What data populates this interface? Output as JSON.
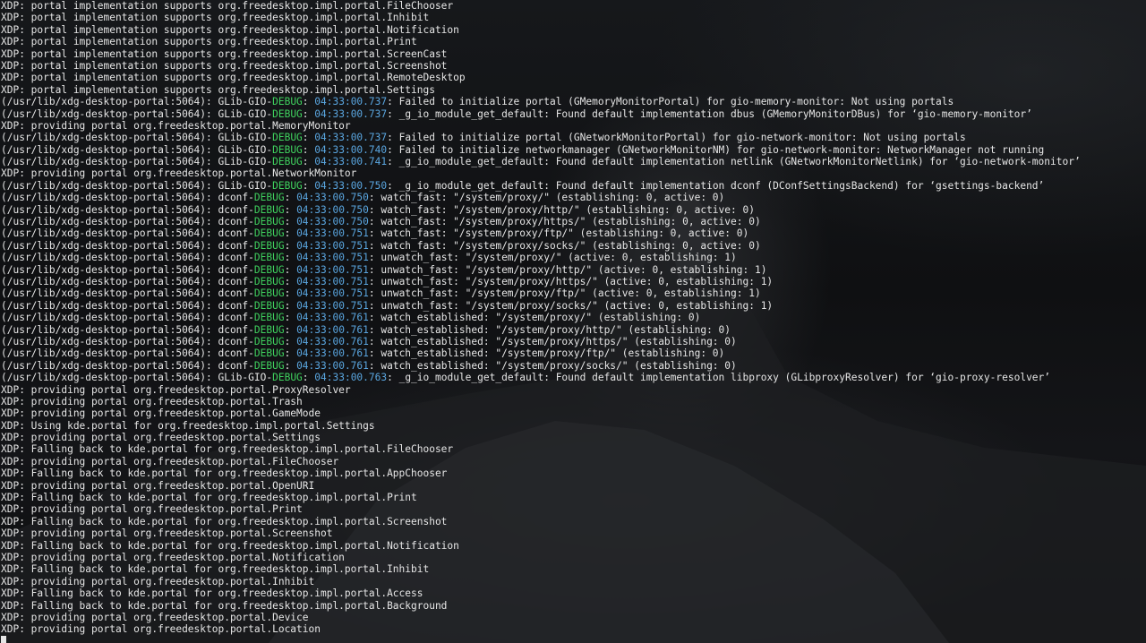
{
  "terminal": {
    "colors": {
      "text": "#e6e6e6",
      "debug": "#3fd15e",
      "timestamp": "#5aa6e0",
      "background": "#0c0d0f"
    },
    "lines": [
      [
        {
          "t": "XDP: portal implementation supports org.freedesktop.impl.portal.FileChooser"
        }
      ],
      [
        {
          "t": "XDP: portal implementation supports org.freedesktop.impl.portal.Inhibit"
        }
      ],
      [
        {
          "t": "XDP: portal implementation supports org.freedesktop.impl.portal.Notification"
        }
      ],
      [
        {
          "t": "XDP: portal implementation supports org.freedesktop.impl.portal.Print"
        }
      ],
      [
        {
          "t": "XDP: portal implementation supports org.freedesktop.impl.portal.ScreenCast"
        }
      ],
      [
        {
          "t": "XDP: portal implementation supports org.freedesktop.impl.portal.Screenshot"
        }
      ],
      [
        {
          "t": "XDP: portal implementation supports org.freedesktop.impl.portal.RemoteDesktop"
        }
      ],
      [
        {
          "t": "XDP: portal implementation supports org.freedesktop.impl.portal.Settings"
        }
      ],
      [
        {
          "t": "(/usr/lib/xdg-desktop-portal:5064): GLib-GIO-"
        },
        {
          "t": "DEBUG",
          "c": "debug"
        },
        {
          "t": ": "
        },
        {
          "t": "04:33:00.737",
          "c": "time"
        },
        {
          "t": ": Failed to initialize portal (GMemoryMonitorPortal) for gio-memory-monitor: Not using portals"
        }
      ],
      [
        {
          "t": "(/usr/lib/xdg-desktop-portal:5064): GLib-GIO-"
        },
        {
          "t": "DEBUG",
          "c": "debug"
        },
        {
          "t": ": "
        },
        {
          "t": "04:33:00.737",
          "c": "time"
        },
        {
          "t": ": _g_io_module_get_default: Found default implementation dbus (GMemoryMonitorDBus) for ‘gio-memory-monitor’"
        }
      ],
      [
        {
          "t": "XDP: providing portal org.freedesktop.portal.MemoryMonitor"
        }
      ],
      [
        {
          "t": "(/usr/lib/xdg-desktop-portal:5064): GLib-GIO-"
        },
        {
          "t": "DEBUG",
          "c": "debug"
        },
        {
          "t": ": "
        },
        {
          "t": "04:33:00.737",
          "c": "time"
        },
        {
          "t": ": Failed to initialize portal (GNetworkMonitorPortal) for gio-network-monitor: Not using portals"
        }
      ],
      [
        {
          "t": "(/usr/lib/xdg-desktop-portal:5064): GLib-GIO-"
        },
        {
          "t": "DEBUG",
          "c": "debug"
        },
        {
          "t": ": "
        },
        {
          "t": "04:33:00.740",
          "c": "time"
        },
        {
          "t": ": Failed to initialize networkmanager (GNetworkMonitorNM) for gio-network-monitor: NetworkManager not running"
        }
      ],
      [
        {
          "t": "(/usr/lib/xdg-desktop-portal:5064): GLib-GIO-"
        },
        {
          "t": "DEBUG",
          "c": "debug"
        },
        {
          "t": ": "
        },
        {
          "t": "04:33:00.741",
          "c": "time"
        },
        {
          "t": ": _g_io_module_get_default: Found default implementation netlink (GNetworkMonitorNetlink) for ‘gio-network-monitor’"
        }
      ],
      [
        {
          "t": "XDP: providing portal org.freedesktop.portal.NetworkMonitor"
        }
      ],
      [
        {
          "t": "(/usr/lib/xdg-desktop-portal:5064): GLib-GIO-"
        },
        {
          "t": "DEBUG",
          "c": "debug"
        },
        {
          "t": ": "
        },
        {
          "t": "04:33:00.750",
          "c": "time"
        },
        {
          "t": ": _g_io_module_get_default: Found default implementation dconf (DConfSettingsBackend) for ‘gsettings-backend’"
        }
      ],
      [
        {
          "t": "(/usr/lib/xdg-desktop-portal:5064): dconf-"
        },
        {
          "t": "DEBUG",
          "c": "debug"
        },
        {
          "t": ": "
        },
        {
          "t": "04:33:00.750",
          "c": "time"
        },
        {
          "t": ": watch_fast: \"/system/proxy/\" (establishing: 0, active: 0)"
        }
      ],
      [
        {
          "t": "(/usr/lib/xdg-desktop-portal:5064): dconf-"
        },
        {
          "t": "DEBUG",
          "c": "debug"
        },
        {
          "t": ": "
        },
        {
          "t": "04:33:00.750",
          "c": "time"
        },
        {
          "t": ": watch_fast: \"/system/proxy/http/\" (establishing: 0, active: 0)"
        }
      ],
      [
        {
          "t": "(/usr/lib/xdg-desktop-portal:5064): dconf-"
        },
        {
          "t": "DEBUG",
          "c": "debug"
        },
        {
          "t": ": "
        },
        {
          "t": "04:33:00.750",
          "c": "time"
        },
        {
          "t": ": watch_fast: \"/system/proxy/https/\" (establishing: 0, active: 0)"
        }
      ],
      [
        {
          "t": "(/usr/lib/xdg-desktop-portal:5064): dconf-"
        },
        {
          "t": "DEBUG",
          "c": "debug"
        },
        {
          "t": ": "
        },
        {
          "t": "04:33:00.751",
          "c": "time"
        },
        {
          "t": ": watch_fast: \"/system/proxy/ftp/\" (establishing: 0, active: 0)"
        }
      ],
      [
        {
          "t": "(/usr/lib/xdg-desktop-portal:5064): dconf-"
        },
        {
          "t": "DEBUG",
          "c": "debug"
        },
        {
          "t": ": "
        },
        {
          "t": "04:33:00.751",
          "c": "time"
        },
        {
          "t": ": watch_fast: \"/system/proxy/socks/\" (establishing: 0, active: 0)"
        }
      ],
      [
        {
          "t": "(/usr/lib/xdg-desktop-portal:5064): dconf-"
        },
        {
          "t": "DEBUG",
          "c": "debug"
        },
        {
          "t": ": "
        },
        {
          "t": "04:33:00.751",
          "c": "time"
        },
        {
          "t": ": unwatch_fast: \"/system/proxy/\" (active: 0, establishing: 1)"
        }
      ],
      [
        {
          "t": "(/usr/lib/xdg-desktop-portal:5064): dconf-"
        },
        {
          "t": "DEBUG",
          "c": "debug"
        },
        {
          "t": ": "
        },
        {
          "t": "04:33:00.751",
          "c": "time"
        },
        {
          "t": ": unwatch_fast: \"/system/proxy/http/\" (active: 0, establishing: 1)"
        }
      ],
      [
        {
          "t": "(/usr/lib/xdg-desktop-portal:5064): dconf-"
        },
        {
          "t": "DEBUG",
          "c": "debug"
        },
        {
          "t": ": "
        },
        {
          "t": "04:33:00.751",
          "c": "time"
        },
        {
          "t": ": unwatch_fast: \"/system/proxy/https/\" (active: 0, establishing: 1)"
        }
      ],
      [
        {
          "t": "(/usr/lib/xdg-desktop-portal:5064): dconf-"
        },
        {
          "t": "DEBUG",
          "c": "debug"
        },
        {
          "t": ": "
        },
        {
          "t": "04:33:00.751",
          "c": "time"
        },
        {
          "t": ": unwatch_fast: \"/system/proxy/ftp/\" (active: 0, establishing: 1)"
        }
      ],
      [
        {
          "t": "(/usr/lib/xdg-desktop-portal:5064): dconf-"
        },
        {
          "t": "DEBUG",
          "c": "debug"
        },
        {
          "t": ": "
        },
        {
          "t": "04:33:00.751",
          "c": "time"
        },
        {
          "t": ": unwatch_fast: \"/system/proxy/socks/\" (active: 0, establishing: 1)"
        }
      ],
      [
        {
          "t": "(/usr/lib/xdg-desktop-portal:5064): dconf-"
        },
        {
          "t": "DEBUG",
          "c": "debug"
        },
        {
          "t": ": "
        },
        {
          "t": "04:33:00.761",
          "c": "time"
        },
        {
          "t": ": watch_established: \"/system/proxy/\" (establishing: 0)"
        }
      ],
      [
        {
          "t": "(/usr/lib/xdg-desktop-portal:5064): dconf-"
        },
        {
          "t": "DEBUG",
          "c": "debug"
        },
        {
          "t": ": "
        },
        {
          "t": "04:33:00.761",
          "c": "time"
        },
        {
          "t": ": watch_established: \"/system/proxy/http/\" (establishing: 0)"
        }
      ],
      [
        {
          "t": "(/usr/lib/xdg-desktop-portal:5064): dconf-"
        },
        {
          "t": "DEBUG",
          "c": "debug"
        },
        {
          "t": ": "
        },
        {
          "t": "04:33:00.761",
          "c": "time"
        },
        {
          "t": ": watch_established: \"/system/proxy/https/\" (establishing: 0)"
        }
      ],
      [
        {
          "t": "(/usr/lib/xdg-desktop-portal:5064): dconf-"
        },
        {
          "t": "DEBUG",
          "c": "debug"
        },
        {
          "t": ": "
        },
        {
          "t": "04:33:00.761",
          "c": "time"
        },
        {
          "t": ": watch_established: \"/system/proxy/ftp/\" (establishing: 0)"
        }
      ],
      [
        {
          "t": "(/usr/lib/xdg-desktop-portal:5064): dconf-"
        },
        {
          "t": "DEBUG",
          "c": "debug"
        },
        {
          "t": ": "
        },
        {
          "t": "04:33:00.761",
          "c": "time"
        },
        {
          "t": ": watch_established: \"/system/proxy/socks/\" (establishing: 0)"
        }
      ],
      [
        {
          "t": "(/usr/lib/xdg-desktop-portal:5064): GLib-GIO-"
        },
        {
          "t": "DEBUG",
          "c": "debug"
        },
        {
          "t": ": "
        },
        {
          "t": "04:33:00.763",
          "c": "time"
        },
        {
          "t": ": _g_io_module_get_default: Found default implementation libproxy (GLibproxyResolver) for ‘gio-proxy-resolver’"
        }
      ],
      [
        {
          "t": "XDP: providing portal org.freedesktop.portal.ProxyResolver"
        }
      ],
      [
        {
          "t": "XDP: providing portal org.freedesktop.portal.Trash"
        }
      ],
      [
        {
          "t": "XDP: providing portal org.freedesktop.portal.GameMode"
        }
      ],
      [
        {
          "t": "XDP: Using kde.portal for org.freedesktop.impl.portal.Settings"
        }
      ],
      [
        {
          "t": "XDP: providing portal org.freedesktop.portal.Settings"
        }
      ],
      [
        {
          "t": "XDP: Falling back to kde.portal for org.freedesktop.impl.portal.FileChooser"
        }
      ],
      [
        {
          "t": "XDP: providing portal org.freedesktop.portal.FileChooser"
        }
      ],
      [
        {
          "t": "XDP: Falling back to kde.portal for org.freedesktop.impl.portal.AppChooser"
        }
      ],
      [
        {
          "t": "XDP: providing portal org.freedesktop.portal.OpenURI"
        }
      ],
      [
        {
          "t": "XDP: Falling back to kde.portal for org.freedesktop.impl.portal.Print"
        }
      ],
      [
        {
          "t": "XDP: providing portal org.freedesktop.portal.Print"
        }
      ],
      [
        {
          "t": "XDP: Falling back to kde.portal for org.freedesktop.impl.portal.Screenshot"
        }
      ],
      [
        {
          "t": "XDP: providing portal org.freedesktop.portal.Screenshot"
        }
      ],
      [
        {
          "t": "XDP: Falling back to kde.portal for org.freedesktop.impl.portal.Notification"
        }
      ],
      [
        {
          "t": "XDP: providing portal org.freedesktop.portal.Notification"
        }
      ],
      [
        {
          "t": "XDP: Falling back to kde.portal for org.freedesktop.impl.portal.Inhibit"
        }
      ],
      [
        {
          "t": "XDP: providing portal org.freedesktop.portal.Inhibit"
        }
      ],
      [
        {
          "t": "XDP: Falling back to kde.portal for org.freedesktop.impl.portal.Access"
        }
      ],
      [
        {
          "t": "XDP: Falling back to kde.portal for org.freedesktop.impl.portal.Background"
        }
      ],
      [
        {
          "t": "XDP: providing portal org.freedesktop.portal.Device"
        }
      ],
      [
        {
          "t": "XDP: providing portal org.freedesktop.portal.Location"
        }
      ]
    ]
  }
}
